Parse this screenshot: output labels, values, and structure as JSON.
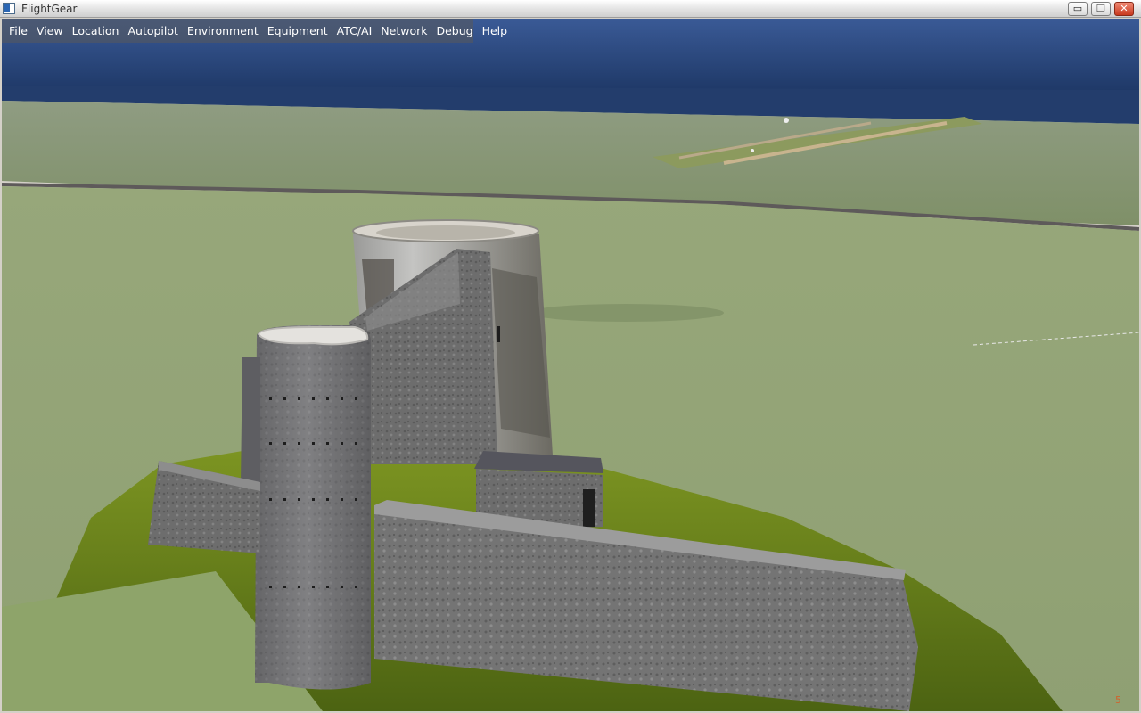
{
  "window": {
    "title": "FlightGear",
    "icon": "app-icon",
    "controls": {
      "minimize": "▭",
      "maximize": "❐",
      "close": "✕"
    }
  },
  "menu": {
    "items": [
      "File",
      "View",
      "Location",
      "Autopilot",
      "Environment",
      "Equipment",
      "ATC/AI",
      "Network",
      "Debug",
      "Help"
    ]
  },
  "hud": {
    "frame_rate": "5"
  },
  "colors": {
    "sky": "#2f4f86",
    "sea": "#233d6c",
    "terrain": "#8a9c6c",
    "grass": "#6f8a1c",
    "stone": "#6e6e6e"
  }
}
